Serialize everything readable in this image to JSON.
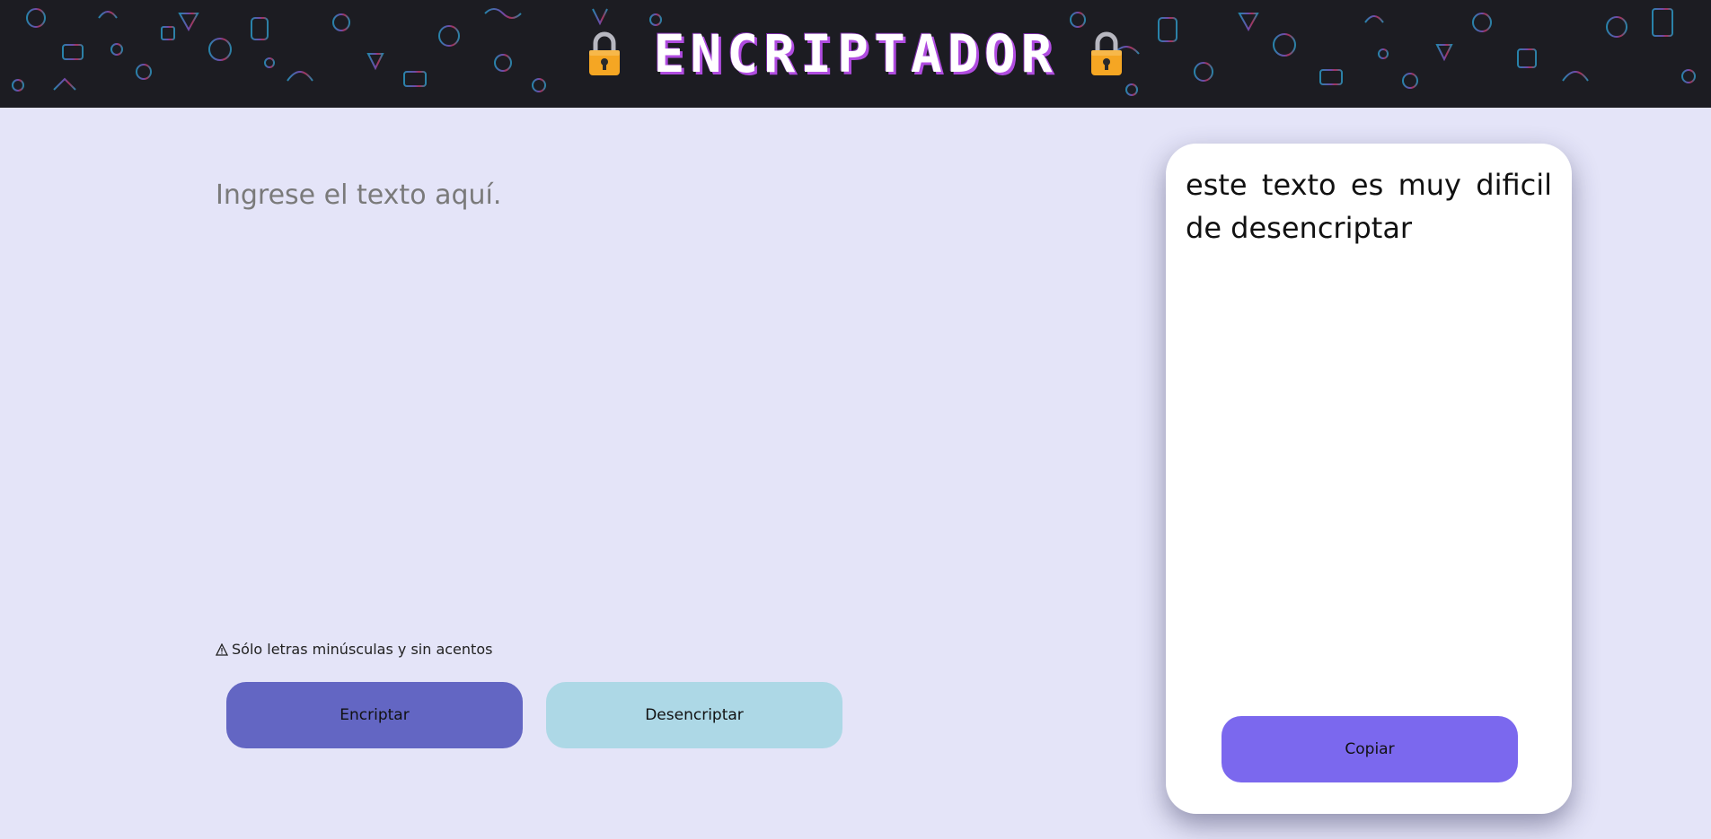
{
  "header": {
    "title": "ENCRIPTADOR",
    "lock_icon": "lock-icon",
    "background_color": "#1c1c22",
    "title_color": "#ffffff",
    "title_shadow_color": "#b04ce0"
  },
  "input": {
    "placeholder": "Ingrese el texto aquí.",
    "value": ""
  },
  "warning": {
    "icon": "warning-icon",
    "text": "Sólo letras minúsculas y sin acentos"
  },
  "buttons": {
    "encrypt_label": "Encriptar",
    "decrypt_label": "Desencriptar",
    "encrypt_color": "#6366c3",
    "decrypt_color": "#add8e6"
  },
  "output": {
    "text": "este texto es muy dificil de desencriptar",
    "copy_label": "Copiar",
    "copy_color": "#7b68ee"
  },
  "page": {
    "background_color": "#e4e4f8"
  }
}
